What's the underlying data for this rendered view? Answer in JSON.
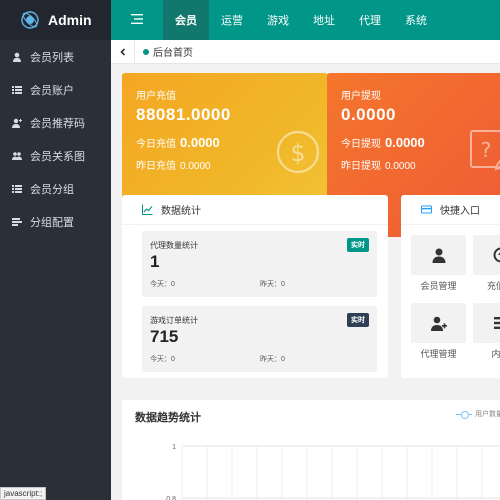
{
  "brand": {
    "name": "Admin",
    "accent": "#009688"
  },
  "sidebar": {
    "items": [
      {
        "label": "会员列表",
        "icon": "user-icon"
      },
      {
        "label": "会员账户",
        "icon": "list-icon"
      },
      {
        "label": "会员推荐码",
        "icon": "user-plus-icon"
      },
      {
        "label": "会员关系图",
        "icon": "users-icon"
      },
      {
        "label": "会员分组",
        "icon": "list-icon"
      },
      {
        "label": "分组配置",
        "icon": "list-icon"
      }
    ]
  },
  "topnav": {
    "menu_icon": "hamburger-icon",
    "items": [
      {
        "label": "会员",
        "active": true
      },
      {
        "label": "运营"
      },
      {
        "label": "游戏"
      },
      {
        "label": "地址"
      },
      {
        "label": "代理"
      },
      {
        "label": "系统"
      }
    ]
  },
  "tabs": {
    "home_label": "后台首页"
  },
  "cards": {
    "recharge": {
      "title": "用户充值",
      "amount": "88081.0000",
      "today_label": "今日充值",
      "today_value": "0.0000",
      "yesterday_label": "昨日充值",
      "yesterday_value": "0.0000",
      "icon": "dollar-coin-icon",
      "color": "#f5a623"
    },
    "withdraw": {
      "title": "用户提现",
      "amount": "0.0000",
      "today_label": "今日提现",
      "today_value": "0.0000",
      "yesterday_label": "昨日提现",
      "yesterday_value": "0.0000",
      "icon": "question-edit-icon",
      "color": "#ee5a36"
    }
  },
  "data_stats": {
    "title": "数据统计",
    "agent": {
      "title": "代理数量统计",
      "badge": "实时",
      "value": "1",
      "today": "今天：0",
      "yesterday": "昨天：0"
    },
    "game": {
      "title": "游戏订单统计",
      "badge": "实时",
      "value": "715",
      "today": "今天：0",
      "yesterday": "昨天：0"
    }
  },
  "quick": {
    "title": "快捷入口",
    "items": [
      {
        "label": "会员管理",
        "icon": "user-icon"
      },
      {
        "label": "充值管",
        "icon": "arrow-circle-icon"
      },
      {
        "label": "代理管理",
        "icon": "user-plus-icon"
      },
      {
        "label": "内容",
        "icon": "list-icon"
      }
    ]
  },
  "trend": {
    "title": "数据趋势统计",
    "legend": "用户数量"
  },
  "chart_data": {
    "type": "line",
    "series": [
      {
        "name": "用户数量",
        "values": []
      }
    ],
    "yticks": [
      "1",
      "0.8"
    ],
    "ylim": [
      0,
      1
    ],
    "grid": true,
    "legend_position": "top-right"
  },
  "status": {
    "text": "javascript:;"
  }
}
